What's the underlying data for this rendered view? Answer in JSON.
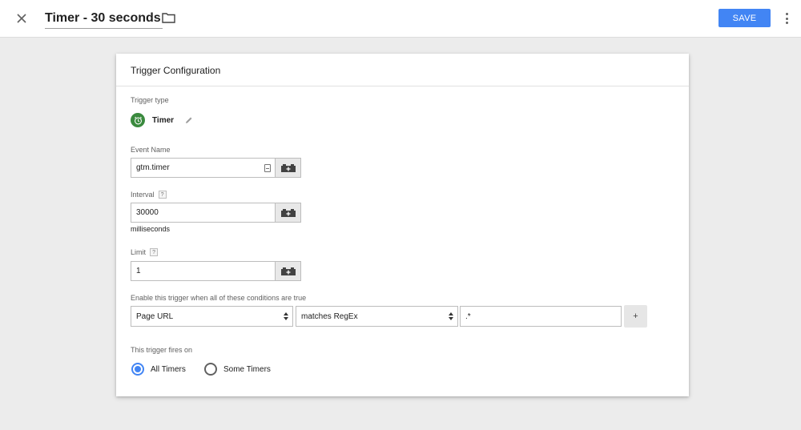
{
  "header": {
    "title": "Timer - 30 seconds",
    "save_label": "SAVE"
  },
  "card": {
    "title": "Trigger Configuration",
    "trigger_type": {
      "label": "Trigger type",
      "name": "Timer",
      "icon": "timer-clock-icon",
      "icon_color": "#3a8a3e"
    },
    "event_name": {
      "label": "Event Name",
      "value": "gtm.timer"
    },
    "interval": {
      "label": "Interval",
      "help": "?",
      "value": "30000",
      "unit": "milliseconds"
    },
    "limit": {
      "label": "Limit",
      "help": "?",
      "value": "1"
    },
    "conditions": {
      "label": "Enable this trigger when all of these conditions are true",
      "variable": "Page URL",
      "operator": "matches RegEx",
      "value": ".*",
      "add_label": "+"
    },
    "fires_on": {
      "label": "This trigger fires on",
      "options": [
        {
          "label": "All Timers",
          "selected": true
        },
        {
          "label": "Some Timers",
          "selected": false
        }
      ]
    }
  },
  "colors": {
    "accent": "#4285f4",
    "background": "#ececec"
  }
}
